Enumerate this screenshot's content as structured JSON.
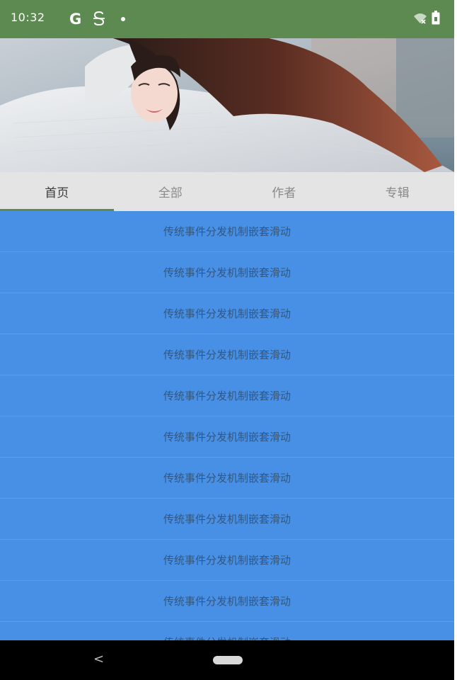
{
  "status_bar": {
    "time": "10:32",
    "background_color": "#5d8a50",
    "left_icons": [
      "google-g-icon",
      "sync-icon",
      "dot-icon"
    ],
    "right_icons": [
      "wifi-off-icon",
      "battery-icon"
    ]
  },
  "banner": {
    "image": "woman-photo"
  },
  "tabs": [
    {
      "label": "首页",
      "active": true
    },
    {
      "label": "全部",
      "active": false
    },
    {
      "label": "作者",
      "active": false
    },
    {
      "label": "专辑",
      "active": false
    }
  ],
  "list": {
    "background_color": "#4790e6",
    "items": [
      "传统事件分发机制嵌套滑动",
      "传统事件分发机制嵌套滑动",
      "传统事件分发机制嵌套滑动",
      "传统事件分发机制嵌套滑动",
      "传统事件分发机制嵌套滑动",
      "传统事件分发机制嵌套滑动",
      "传统事件分发机制嵌套滑动",
      "传统事件分发机制嵌套滑动",
      "传统事件分发机制嵌套滑动",
      "传统事件分发机制嵌套滑动",
      "传统事件分发机制嵌套滑动"
    ]
  },
  "nav_bar": {
    "back_glyph": "<",
    "icons": [
      "back-icon",
      "home-pill-icon"
    ]
  }
}
